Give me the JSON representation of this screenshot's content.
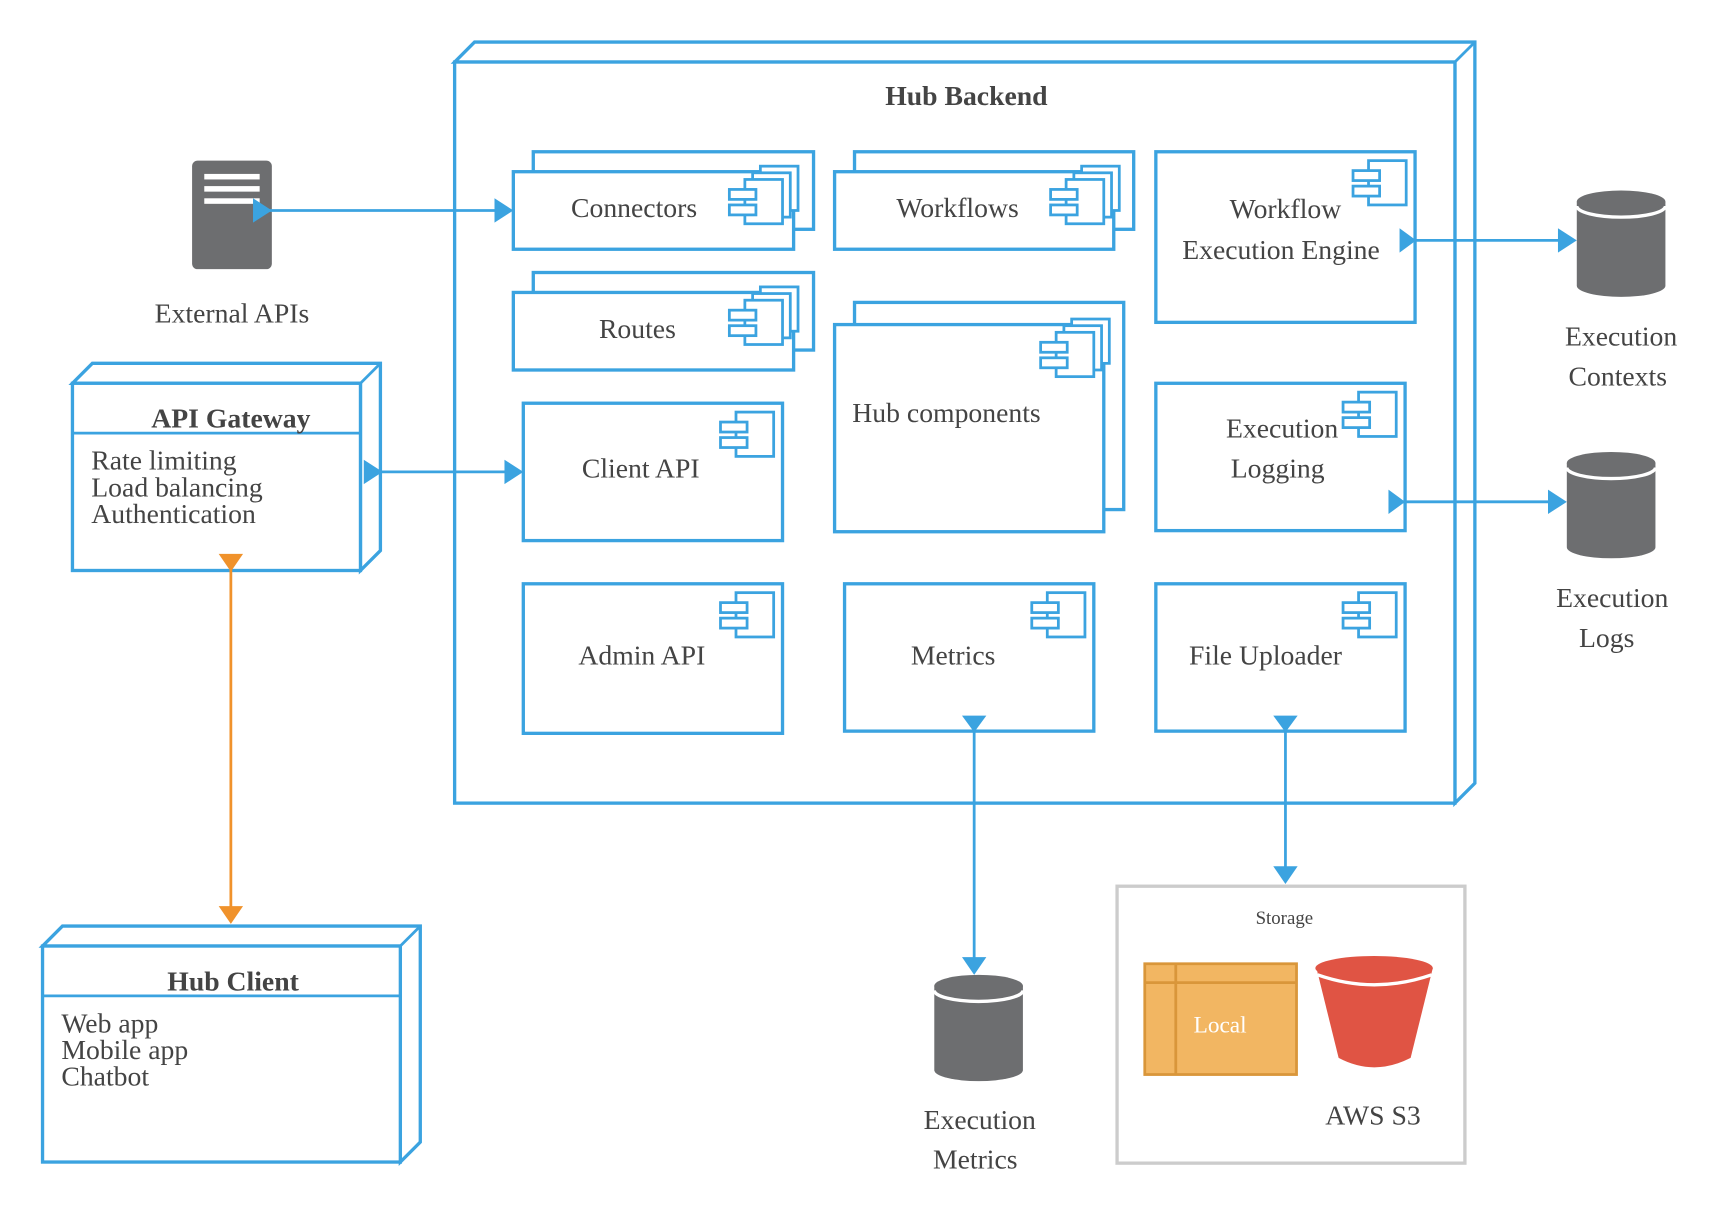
{
  "colors": {
    "accent": "#3ba3e0",
    "orange": "#f0922b",
    "database": "#6d6e70",
    "s3": "#e05444",
    "local": "#f2b662"
  },
  "backend": {
    "title": "Hub Backend",
    "connectors": "Connectors",
    "workflows": "Workflows",
    "engine_line1": "Workflow",
    "engine_line2": "Execution Engine",
    "routes": "Routes",
    "hub_components": "Hub components",
    "logging_line1": "Execution",
    "logging_line2": "Logging",
    "client_api": "Client API",
    "admin_api": "Admin API",
    "metrics": "Metrics",
    "file_uploader": "File Uploader"
  },
  "external_apis": "External APIs",
  "gateway": {
    "title": "API Gateway",
    "items": [
      "Rate limiting",
      "Load balancing",
      "Authentication"
    ]
  },
  "client": {
    "title": "Hub Client",
    "items": [
      "Web app",
      "Mobile app",
      "Chatbot"
    ]
  },
  "stores": {
    "contexts_line1": "Execution",
    "contexts_line2": "Contexts",
    "logs_line1": "Execution",
    "logs_line2": "Logs",
    "metrics_line1": "Execution",
    "metrics_line2": "Metrics"
  },
  "storage": {
    "title": "Storage",
    "local": "Local",
    "s3": "AWS S3"
  }
}
